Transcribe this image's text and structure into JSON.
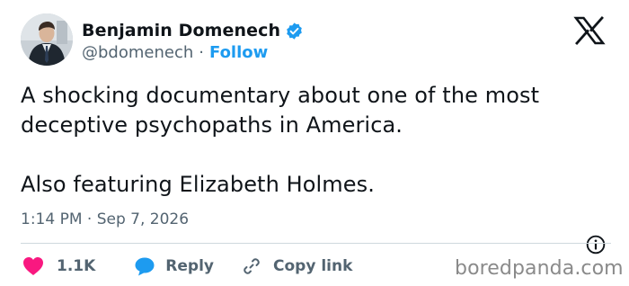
{
  "author": {
    "name": "Benjamin Domenech",
    "handle": "@bdomenech",
    "separator": "·",
    "follow_label": "Follow",
    "verified_color": "#1d9bf0"
  },
  "tweet": {
    "text": "A shocking documentary about one of the most\ndeceptive psychopaths in America.\n\nAlso featuring Elizabeth Holmes.",
    "timestamp": "1:14 PM · Sep 7, 2026"
  },
  "actions": {
    "like_count": "1.1K",
    "like_color": "#f91880",
    "reply_label": "Reply",
    "reply_color": "#1d9bf0",
    "copy_label": "Copy link"
  },
  "icons": {
    "platform": "x-logo-icon",
    "info": "info-icon",
    "like": "heart-icon",
    "reply": "reply-bubble-icon",
    "copy": "link-icon"
  },
  "watermark": "boredpanda.com"
}
